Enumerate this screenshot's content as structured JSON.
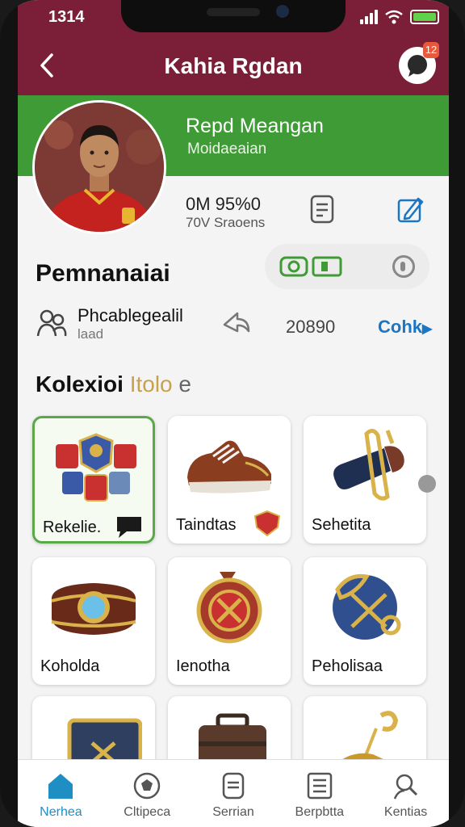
{
  "status_bar": {
    "time": "1314"
  },
  "header": {
    "title": "Kahia Rgdan",
    "badge": "12"
  },
  "profile": {
    "name": "Repd Meangan",
    "subtitle": "Moidaeaian",
    "stat_value": "0M 95%0",
    "stat_label": "70V Sraoens"
  },
  "section": {
    "title": "Pemnanaiai"
  },
  "item_row": {
    "title": "Phcablegealil",
    "subtitle": "laad",
    "number": "20890",
    "link": "Cohk"
  },
  "collection": {
    "title_main": "Kolexioi",
    "title_accent": "Itolo",
    "title_tail": "e",
    "items": [
      {
        "label": "Rekelie.",
        "icon": "badge-cluster"
      },
      {
        "label": "Taindtas",
        "icon": "sneaker"
      },
      {
        "label": "Sehetita",
        "icon": "horn"
      },
      {
        "label": "Koholda",
        "icon": "gem-bracelet"
      },
      {
        "label": "Ienotha",
        "icon": "medal"
      },
      {
        "label": "Peholisaa",
        "icon": "globe-emblem"
      },
      {
        "label": "",
        "icon": "framed-emblem"
      },
      {
        "label": "",
        "icon": "briefcase"
      },
      {
        "label": "",
        "icon": "golden-horn"
      }
    ]
  },
  "bottom_nav": [
    {
      "label": "Nerhea",
      "icon": "home-icon",
      "active": true
    },
    {
      "label": "Cltipeca",
      "icon": "ball-icon",
      "active": false
    },
    {
      "label": "Serrian",
      "icon": "card-icon",
      "active": false
    },
    {
      "label": "Berpbtta",
      "icon": "list-icon",
      "active": false
    },
    {
      "label": "Kentias",
      "icon": "profile-icon",
      "active": false
    }
  ],
  "colors": {
    "header": "#7a1f37",
    "profile_band": "#3f9b35",
    "link": "#1b76c4",
    "accent_gold": "#c8a24a"
  }
}
